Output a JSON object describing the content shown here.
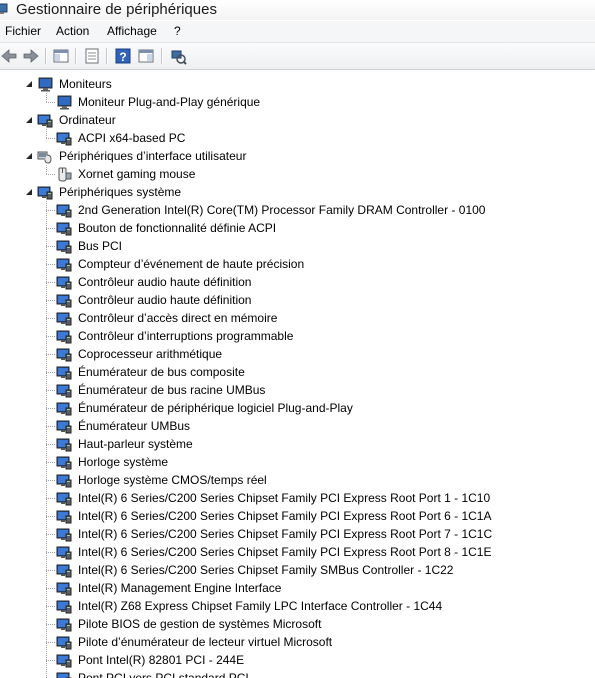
{
  "window": {
    "title": "Gestionnaire de périphériques"
  },
  "menu": [
    "Fichier",
    "Action",
    "Affichage",
    "?"
  ],
  "toolbar": [
    {
      "name": "back-button-icon"
    },
    {
      "name": "forward-button-icon"
    },
    {
      "name": "show-hide-console-tree-icon"
    },
    {
      "name": "properties-icon"
    },
    {
      "name": "help-icon"
    },
    {
      "name": "action-pane-icon"
    },
    {
      "name": "scan-hardware-changes-icon"
    }
  ],
  "tree": {
    "categories": [
      {
        "label": "Moniteurs",
        "icon": "monitor-icon",
        "expanded": true,
        "children": [
          "Moniteur Plug-and-Play générique"
        ]
      },
      {
        "label": "Ordinateur",
        "icon": "computer-icon",
        "expanded": true,
        "children": [
          "ACPI x64-based PC"
        ]
      },
      {
        "label": "Périphériques d’interface utilisateur",
        "icon": "hid-icon",
        "expanded": true,
        "children": [
          "Xornet gaming mouse"
        ]
      },
      {
        "label": "Périphériques système",
        "icon": "system-device-icon",
        "expanded": true,
        "children": [
          "2nd Generation Intel(R) Core(TM) Processor Family DRAM Controller - 0100",
          "Bouton de fonctionnalité définie ACPI",
          "Bus PCI",
          "Compteur d’événement de haute précision",
          "Contrôleur audio haute définition",
          "Contrôleur audio haute définition",
          "Contrôleur d’accès direct en mémoire",
          "Contrôleur d’interruptions programmable",
          "Coprocesseur arithmétique",
          "Énumérateur de bus composite",
          "Énumérateur de bus racine UMBus",
          "Énumérateur de périphérique logiciel Plug-and-Play",
          "Énumérateur UMBus",
          "Haut-parleur système",
          "Horloge système",
          "Horloge système CMOS/temps réel",
          "Intel(R) 6 Series/C200 Series Chipset Family PCI Express Root Port 1 - 1C10",
          "Intel(R) 6 Series/C200 Series Chipset Family PCI Express Root Port 6 - 1C1A",
          "Intel(R) 6 Series/C200 Series Chipset Family PCI Express Root Port 7 - 1C1C",
          "Intel(R) 6 Series/C200 Series Chipset Family PCI Express Root Port 8 - 1C1E",
          "Intel(R) 6 Series/C200 Series Chipset Family SMBus Controller - 1C22",
          "Intel(R) Management Engine Interface",
          "Intel(R) Z68 Express Chipset Family LPC Interface Controller - 1C44",
          "Pilote BIOS de gestion de systèmes Microsoft",
          "Pilote d’énumérateur de lecteur virtuel Microsoft",
          "Pont Intel(R) 82801 PCI - 244E",
          "Pont PCI vers PCI standard PCI"
        ]
      }
    ]
  }
}
